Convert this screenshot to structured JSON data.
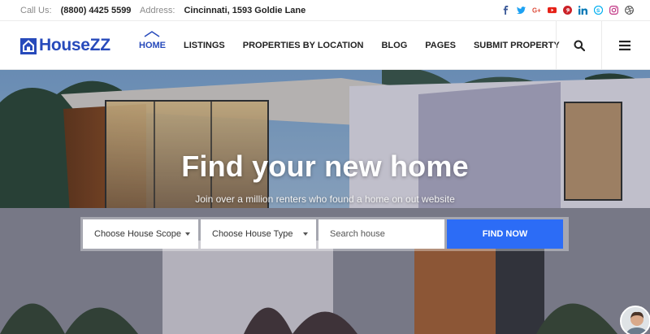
{
  "topbar": {
    "call_label": "Call Us:",
    "call_value": "(8800) 4425 5599",
    "address_label": "Address:",
    "address_value": "Cincinnati, 1593 Goldie Lane",
    "socials": [
      {
        "icon": "facebook-icon",
        "color": "#3b5998"
      },
      {
        "icon": "twitter-icon",
        "color": "#1da1f2"
      },
      {
        "icon": "google-plus-icon",
        "color": "#dd4b39"
      },
      {
        "icon": "youtube-icon",
        "color": "#e62117"
      },
      {
        "icon": "pinterest-icon",
        "color": "#cb2027"
      },
      {
        "icon": "linkedin-icon",
        "color": "#0077b5"
      },
      {
        "icon": "skype-icon",
        "color": "#00aff0"
      },
      {
        "icon": "instagram-icon",
        "color": "#c13584"
      },
      {
        "icon": "dribbble-icon",
        "color": "#444444"
      }
    ]
  },
  "header": {
    "logo_text": "HouseZZ",
    "brand_color": "#274abb",
    "nav": [
      {
        "label": "HOME",
        "active": true
      },
      {
        "label": "LISTINGS",
        "active": false
      },
      {
        "label": "PROPERTIES BY LOCATION",
        "active": false
      },
      {
        "label": "BLOG",
        "active": false
      },
      {
        "label": "PAGES",
        "active": false
      },
      {
        "label": "SUBMIT PROPERTY",
        "active": false
      }
    ],
    "search_icon": "search-icon",
    "menu_icon": "hamburger-menu-icon"
  },
  "hero": {
    "title": "Find your new home",
    "subtitle": "Join over a million renters who found a home on out website",
    "search": {
      "scope_selected": "Choose House Scope",
      "type_selected": "Choose House Type",
      "input_placeholder": "Search house",
      "button_label": "FIND NOW",
      "button_color": "#2c6cf6"
    }
  }
}
